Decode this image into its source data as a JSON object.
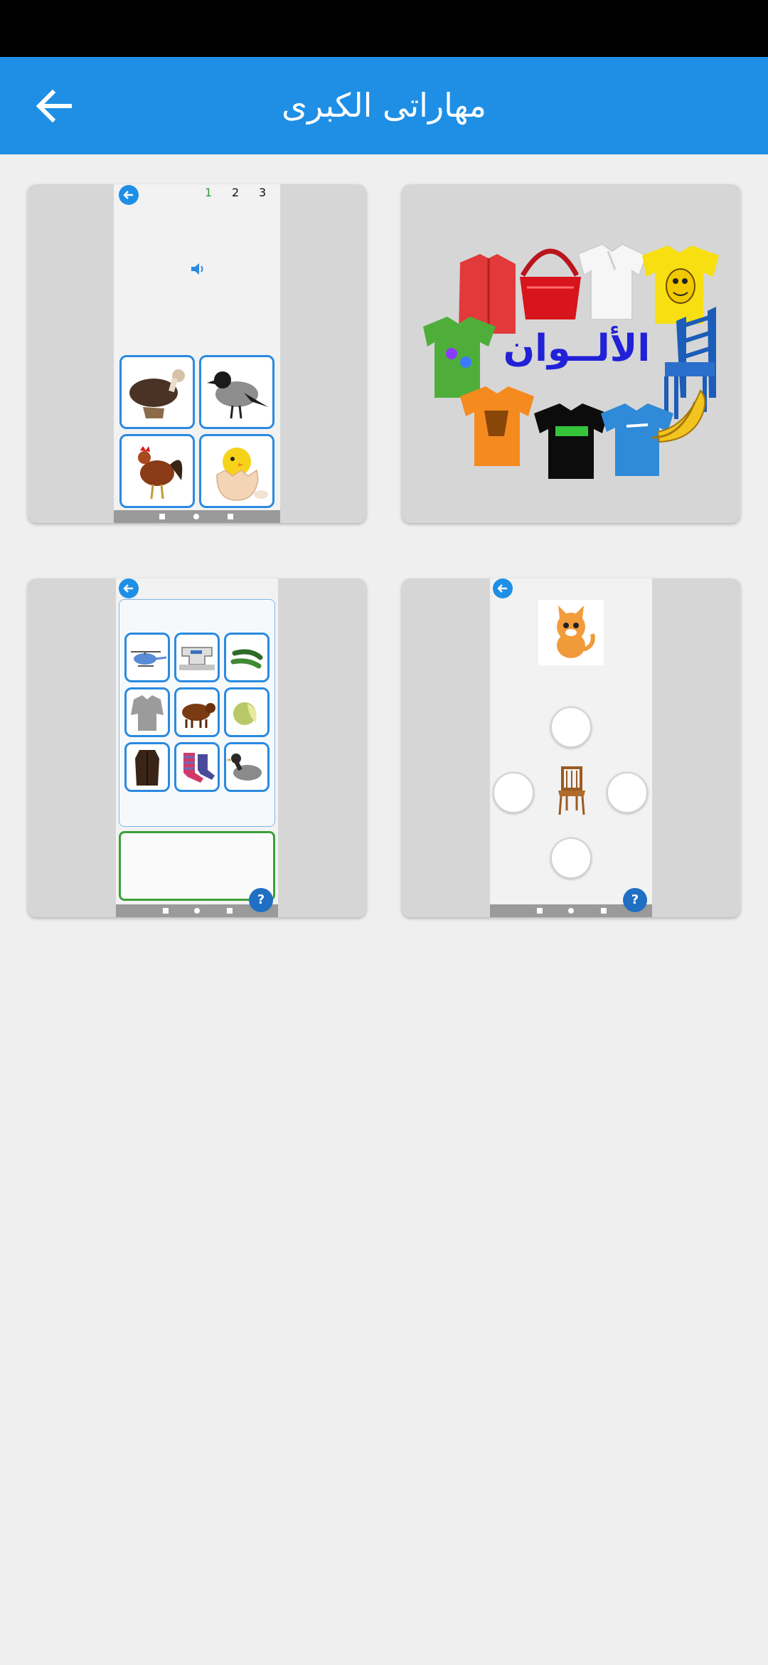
{
  "app_bar": {
    "title": "مهاراتى الكبرى",
    "back_icon": "arrow-left-icon",
    "color": "#1f8fe5"
  },
  "cards": [
    {
      "name": "colors-card",
      "title": "الألــوان",
      "items": [
        "red-cardigan",
        "red-handbag",
        "white-polo-shirt",
        "yellow-tshirt",
        "green-tshirt",
        "blue-chair",
        "orange-tshirt",
        "black-tshirt",
        "blue-tshirt",
        "bananas"
      ]
    },
    {
      "name": "sound-quiz-card",
      "pages": [
        "1",
        "2",
        "3"
      ],
      "active_page": "1",
      "icons": [
        "speaker-icon"
      ],
      "tiles": [
        "vulture",
        "crow",
        "rooster",
        "chick-in-egg"
      ]
    },
    {
      "name": "position-quiz-card",
      "icons": [
        "cat-image",
        "chair-image",
        "help-icon"
      ],
      "help_label": "?"
    },
    {
      "name": "grid-sort-card",
      "tiles": [
        "helicopter",
        "sewing-machine",
        "cucumber",
        "blouse",
        "bull",
        "melon",
        "coat",
        "socks",
        "duck"
      ],
      "help_label": "?"
    }
  ]
}
